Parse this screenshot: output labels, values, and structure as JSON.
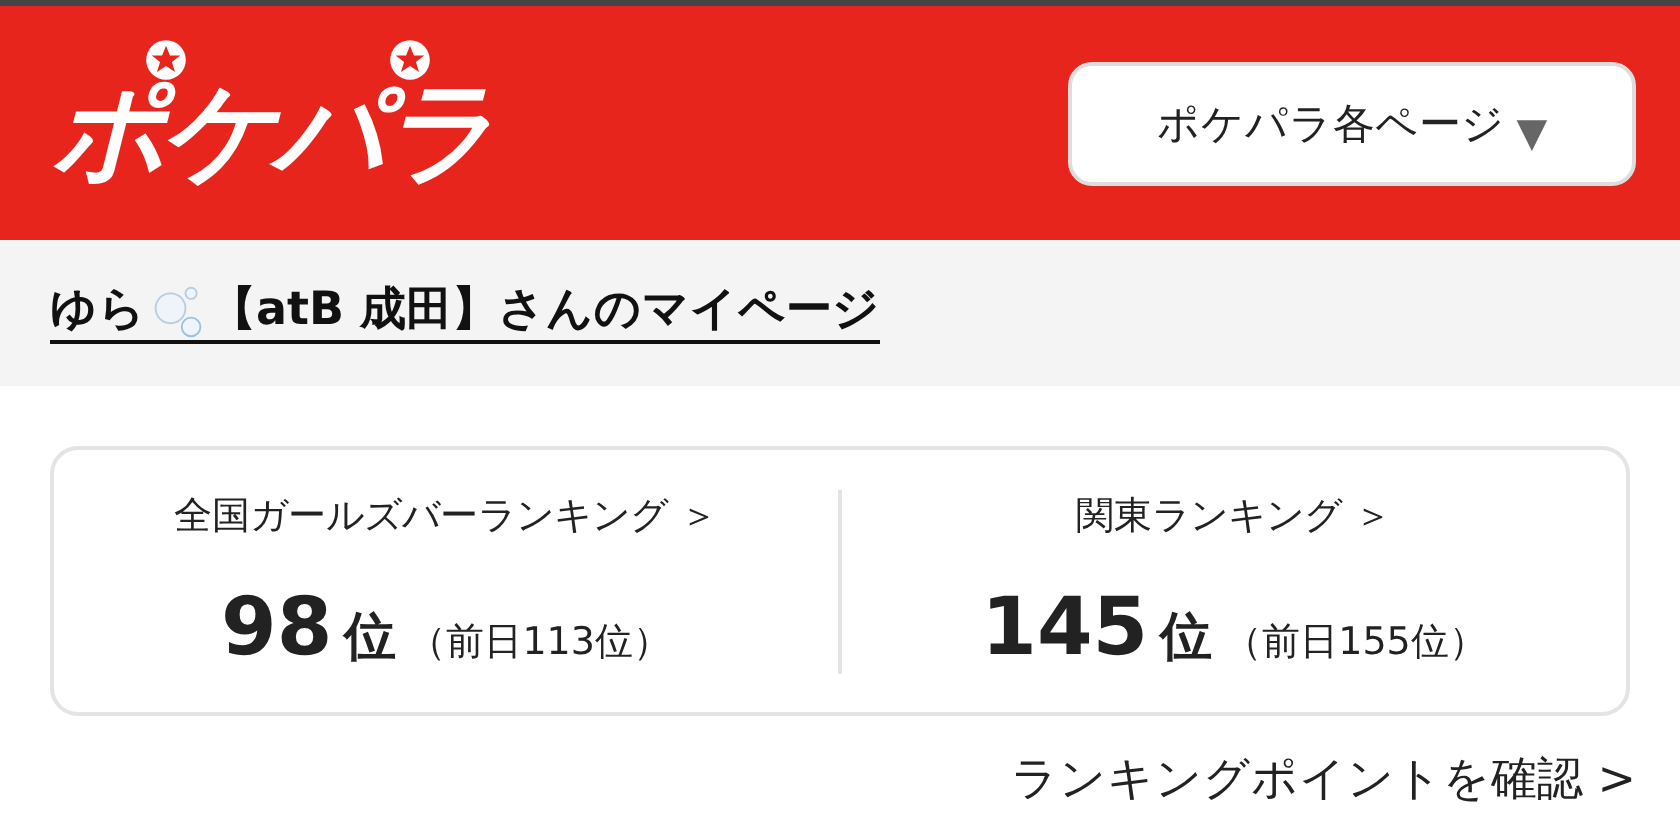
{
  "header": {
    "logo": "ポケパラ",
    "menu": {
      "label": "ポケパラ各ページ",
      "caret": "▼"
    }
  },
  "page_title": {
    "name": "ゆら",
    "rest": "【atB 成田】さんのマイページ"
  },
  "rankings": [
    {
      "label": "全国ガールズバーランキング ＞",
      "rank": "98",
      "unit": "位",
      "previous": "（前日113位）"
    },
    {
      "label": "関東ランキング ＞",
      "rank": "145",
      "unit": "位",
      "previous": "（前日155位）"
    }
  ],
  "points_link": "ランキングポイントを確認 >"
}
